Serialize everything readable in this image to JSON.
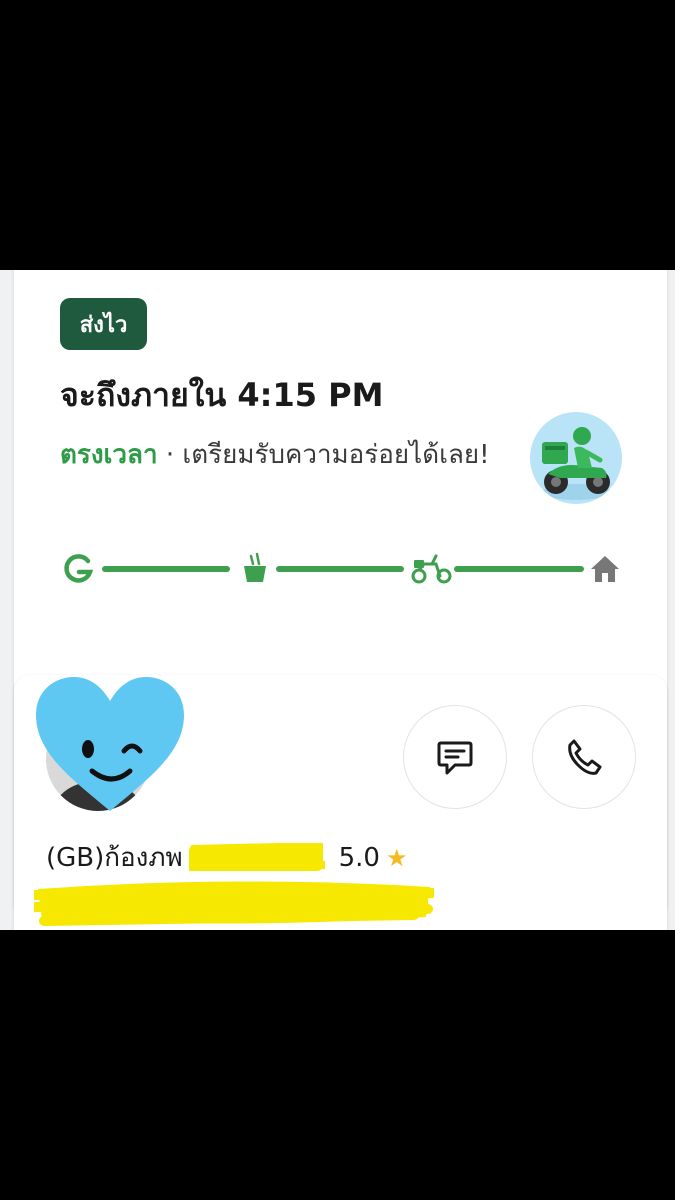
{
  "order": {
    "badge": "ส่งไว",
    "eta_title": "จะถึงภายใน 4:15 PM",
    "status_ontime": "ตรงเวลา",
    "status_separator": " · ",
    "status_text": "เตรียมรับความอร่อยได้เลย!",
    "progress_steps": [
      "grab-logo-icon",
      "food-bowl-icon",
      "scooter-icon",
      "home-icon"
    ],
    "colors": {
      "accent": "#3ea04e",
      "badge_bg": "#1f5a3e",
      "home_icon": "#777777"
    }
  },
  "driver": {
    "name": "(GB)ก้องภพ",
    "rating": "5.0",
    "actions": [
      "chat-icon",
      "phone-icon"
    ]
  }
}
